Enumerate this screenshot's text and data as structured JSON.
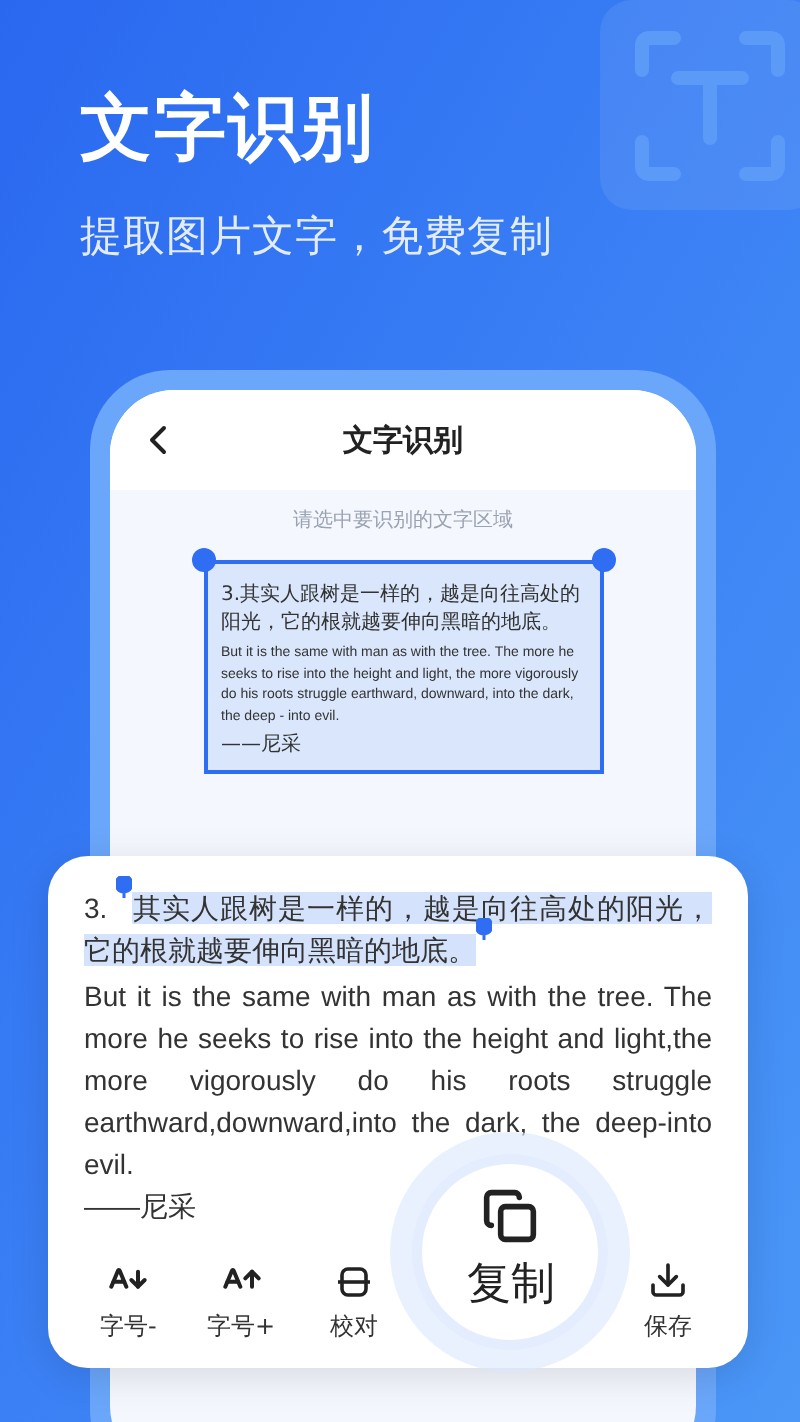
{
  "headline": "文字识别",
  "subtitle": "提取图片文字，免费复制",
  "app": {
    "title": "文字识别",
    "hint": "请选中要识别的文字区域",
    "document": {
      "chinese": "3.其实人跟树是一样的，越是向往高处的阳光，它的根就越要伸向黑暗的地底。",
      "english": "But it is the same with man as with the tree. The more he seeks to rise into the height and light, the more vigorously do his roots struggle earthward, downward, into the dark, the deep - into evil.",
      "author": "——尼采"
    }
  },
  "result": {
    "paragraphs": [
      {
        "prefix": "3.",
        "text": "其实人跟树是一样的，越是向往高处的阳光，它的根就越要伸向黑暗的地底。",
        "selected": true
      },
      {
        "text": "But it is the same with man as with the tree. The more he seeks to rise into the height and light,the more vigorously do his roots struggle earthward,downward,into the dark, the deep-into evil.",
        "selected": false
      },
      {
        "text": "——尼采",
        "selected": false
      }
    ]
  },
  "toolbar": [
    {
      "kind": "font-smaller",
      "label": "字号-"
    },
    {
      "kind": "font-larger",
      "label": "字号+"
    },
    {
      "kind": "proofread",
      "label": "校对"
    },
    {
      "kind": "copy",
      "label": "复制"
    },
    {
      "kind": "save",
      "label": "保存"
    }
  ]
}
